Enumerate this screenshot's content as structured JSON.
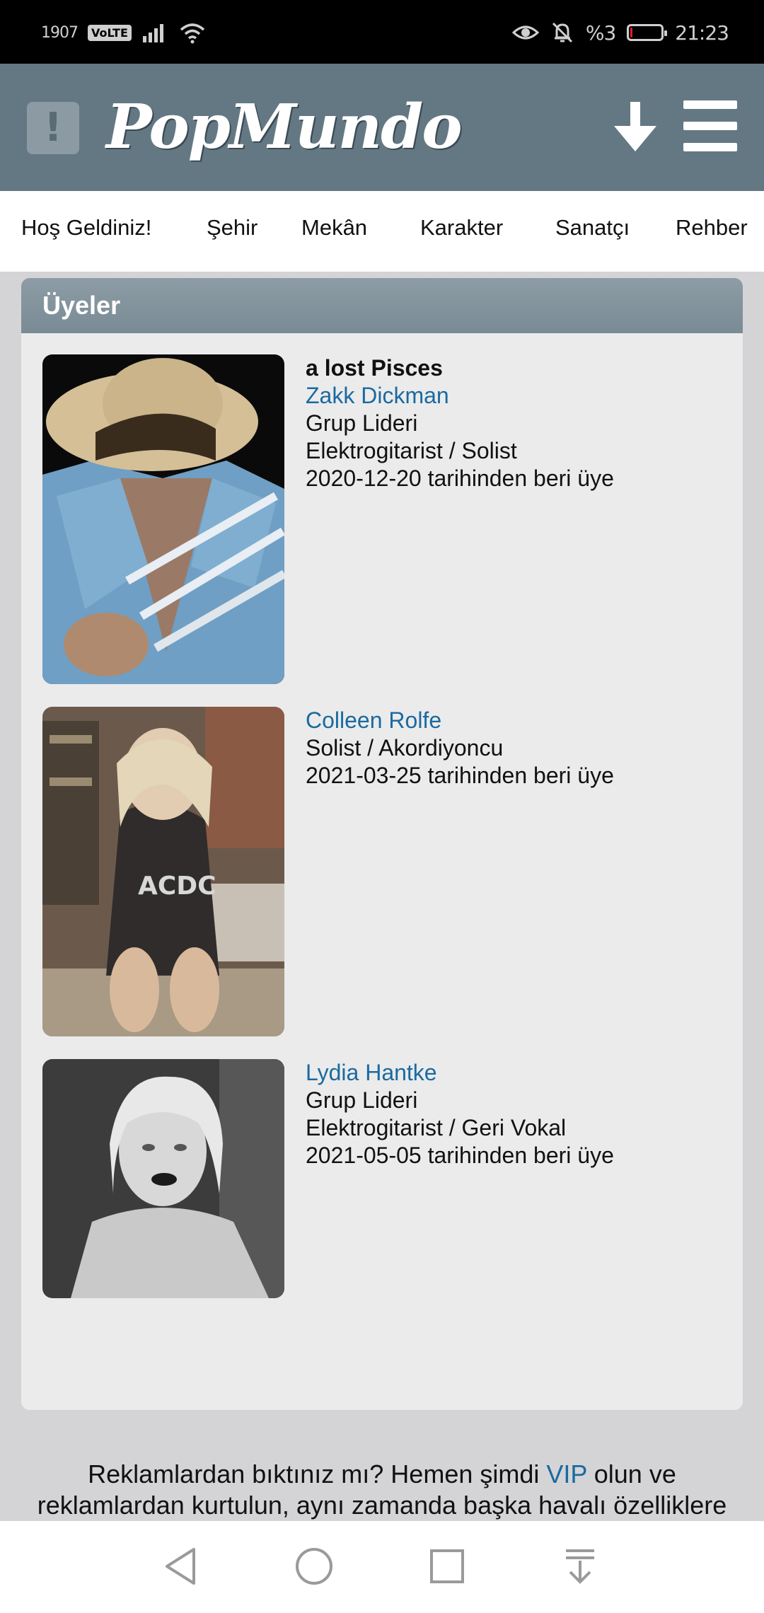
{
  "status_bar": {
    "net_speed": "1907",
    "volte": "VoLTE",
    "battery_percent": "%3",
    "time": "21:23",
    "battery_level": 0.08,
    "icons": [
      "signal-icon",
      "wifi-icon",
      "eye-icon",
      "bell-off-icon",
      "battery-icon"
    ]
  },
  "header": {
    "logo": "PopMundo",
    "icons": [
      "alert-icon",
      "download-icon",
      "menu-icon"
    ]
  },
  "nav": {
    "items": [
      "Hoş Geldiniz!",
      "Şehir",
      "Mekân",
      "Karakter",
      "Sanatçı",
      "Rehber"
    ]
  },
  "members_section": {
    "title": "Üyeler",
    "members": [
      {
        "band": "a lost Pisces",
        "name": "Zakk Dickman",
        "lines": [
          "Grup Lideri",
          "Elektrogitarist / Solist",
          "2020-12-20 tarihinden beri üye"
        ]
      },
      {
        "name": "Colleen Rolfe",
        "lines": [
          "Solist / Akordiyoncu",
          "2021-03-25 tarihinden beri üye"
        ]
      },
      {
        "name": "Lydia Hantke",
        "lines": [
          "Grup Lideri",
          "Elektrogitarist / Geri Vokal",
          "2021-05-05 tarihinden beri üye"
        ]
      }
    ]
  },
  "ad": {
    "line1_before": "Reklamlardan bıktınız mı? Hemen şimdi ",
    "vip_link": "VIP",
    "line1_after": " olun ve",
    "line2": "reklamlardan kurtulun, aynı zamanda başka havalı özelliklere"
  },
  "bottom_nav": {
    "icons": [
      "back-icon",
      "home-icon",
      "recents-icon",
      "notification-pull-icon"
    ]
  },
  "colors": {
    "header_bg": "#647884",
    "link": "#1a6aa0",
    "card_bg": "#ebebeb"
  }
}
